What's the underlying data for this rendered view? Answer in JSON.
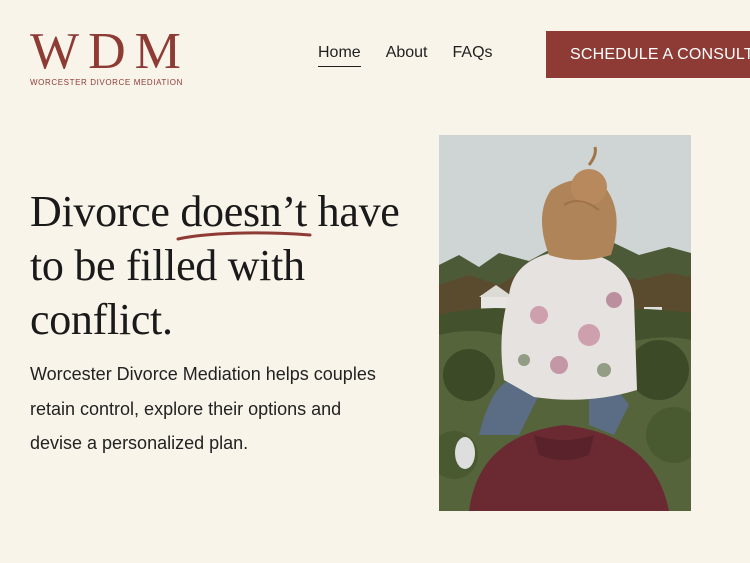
{
  "brand": {
    "logo_text": "WDM",
    "subtitle": "WORCESTER DIVORCE MEDIATION"
  },
  "nav": {
    "items": [
      {
        "label": "Home",
        "active": true
      },
      {
        "label": "About",
        "active": false
      },
      {
        "label": "FAQs",
        "active": false
      }
    ]
  },
  "cta": {
    "label": "SCHEDULE A CONSULTATION"
  },
  "hero": {
    "headline_start": "Divorce ",
    "headline_emphasis": "doesn’t",
    "headline_end": " have to be filled with conflict.",
    "subtext": "Worcester Divorce Mediation helps couples retain control, explore their options and devise a personalized plan."
  },
  "colors": {
    "background": "#f9f4ea",
    "accent": "#8e3b35",
    "text": "#1f1f1f"
  }
}
